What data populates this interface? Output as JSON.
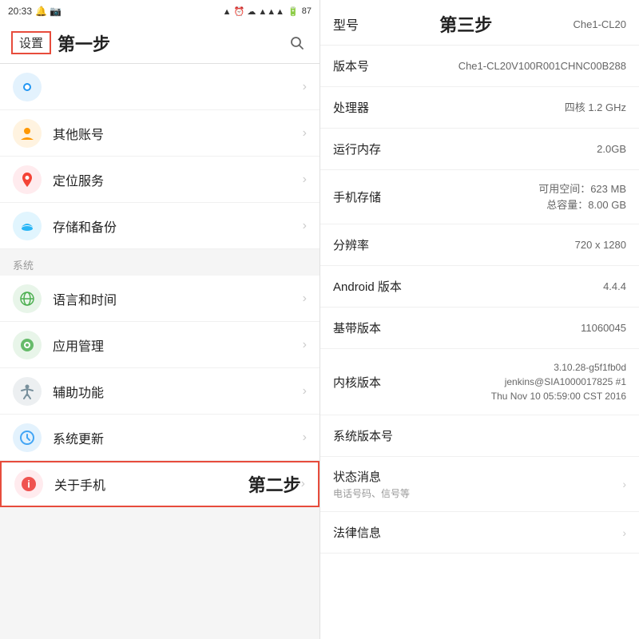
{
  "statusBar": {
    "time": "20:33",
    "battery": "87"
  },
  "leftPanel": {
    "settingsLabel": "设置",
    "pageTitle": "第一步",
    "sectionSystem": "系统",
    "items": [
      {
        "id": "hotspot",
        "label": "",
        "iconColor": "#2196F3",
        "iconChar": "●",
        "showLabel": false
      },
      {
        "id": "other-account",
        "label": "其他账号",
        "iconColor": "#FF9800",
        "iconChar": "👤"
      },
      {
        "id": "location",
        "label": "定位服务",
        "iconColor": "#F44336",
        "iconChar": "📍"
      },
      {
        "id": "storage",
        "label": "存储和备份",
        "iconColor": "#29B6F6",
        "iconChar": "☁"
      },
      {
        "id": "language",
        "label": "语言和时间",
        "iconColor": "#4CAF50",
        "iconChar": "🌐"
      },
      {
        "id": "app-manage",
        "label": "应用管理",
        "iconColor": "#66BB6A",
        "iconChar": "⚙"
      },
      {
        "id": "accessibility",
        "label": "辅助功能",
        "iconColor": "#78909C",
        "iconChar": "✋"
      },
      {
        "id": "system-update",
        "label": "系统更新",
        "iconColor": "#42A5F5",
        "iconChar": "🔄"
      },
      {
        "id": "about",
        "label": "关于手机",
        "iconColor": "#EF5350",
        "iconChar": "ℹ",
        "highlighted": true
      }
    ],
    "step2Label": "第二步"
  },
  "rightPanel": {
    "pageTitle": "第三步",
    "rows": [
      {
        "id": "model",
        "label": "型号",
        "value": "Che1-CL20",
        "clickable": false
      },
      {
        "id": "version",
        "label": "版本号",
        "value": "Che1-CL20V100R001CHNC00B288",
        "clickable": false
      },
      {
        "id": "processor",
        "label": "处理器",
        "value": "四核 1.2 GHz",
        "clickable": false
      },
      {
        "id": "ram",
        "label": "运行内存",
        "value": "2.0GB",
        "clickable": false
      },
      {
        "id": "storage",
        "label": "手机存储",
        "value": "可用空间：623 MB\n总容量：8.00 GB",
        "clickable": false
      },
      {
        "id": "resolution",
        "label": "分辨率",
        "value": "720 x 1280",
        "clickable": false
      },
      {
        "id": "android",
        "label": "Android 版本",
        "value": "4.4.4",
        "clickable": false
      },
      {
        "id": "baseband",
        "label": "基带版本",
        "value": "11060045",
        "clickable": false
      },
      {
        "id": "kernel",
        "label": "内核版本",
        "value": "3.10.28-g5f1fb0d\njenkins@SIA1000017825 #1\nThu Nov 10 05:59:00 CST 2016",
        "clickable": false
      },
      {
        "id": "system-ver",
        "label": "系统版本号",
        "value": "",
        "clickable": false
      },
      {
        "id": "status",
        "label": "状态消息",
        "sublabel": "电话号码、信号等",
        "value": "",
        "clickable": true
      },
      {
        "id": "legal",
        "label": "法律信息",
        "value": "",
        "clickable": true
      }
    ]
  }
}
